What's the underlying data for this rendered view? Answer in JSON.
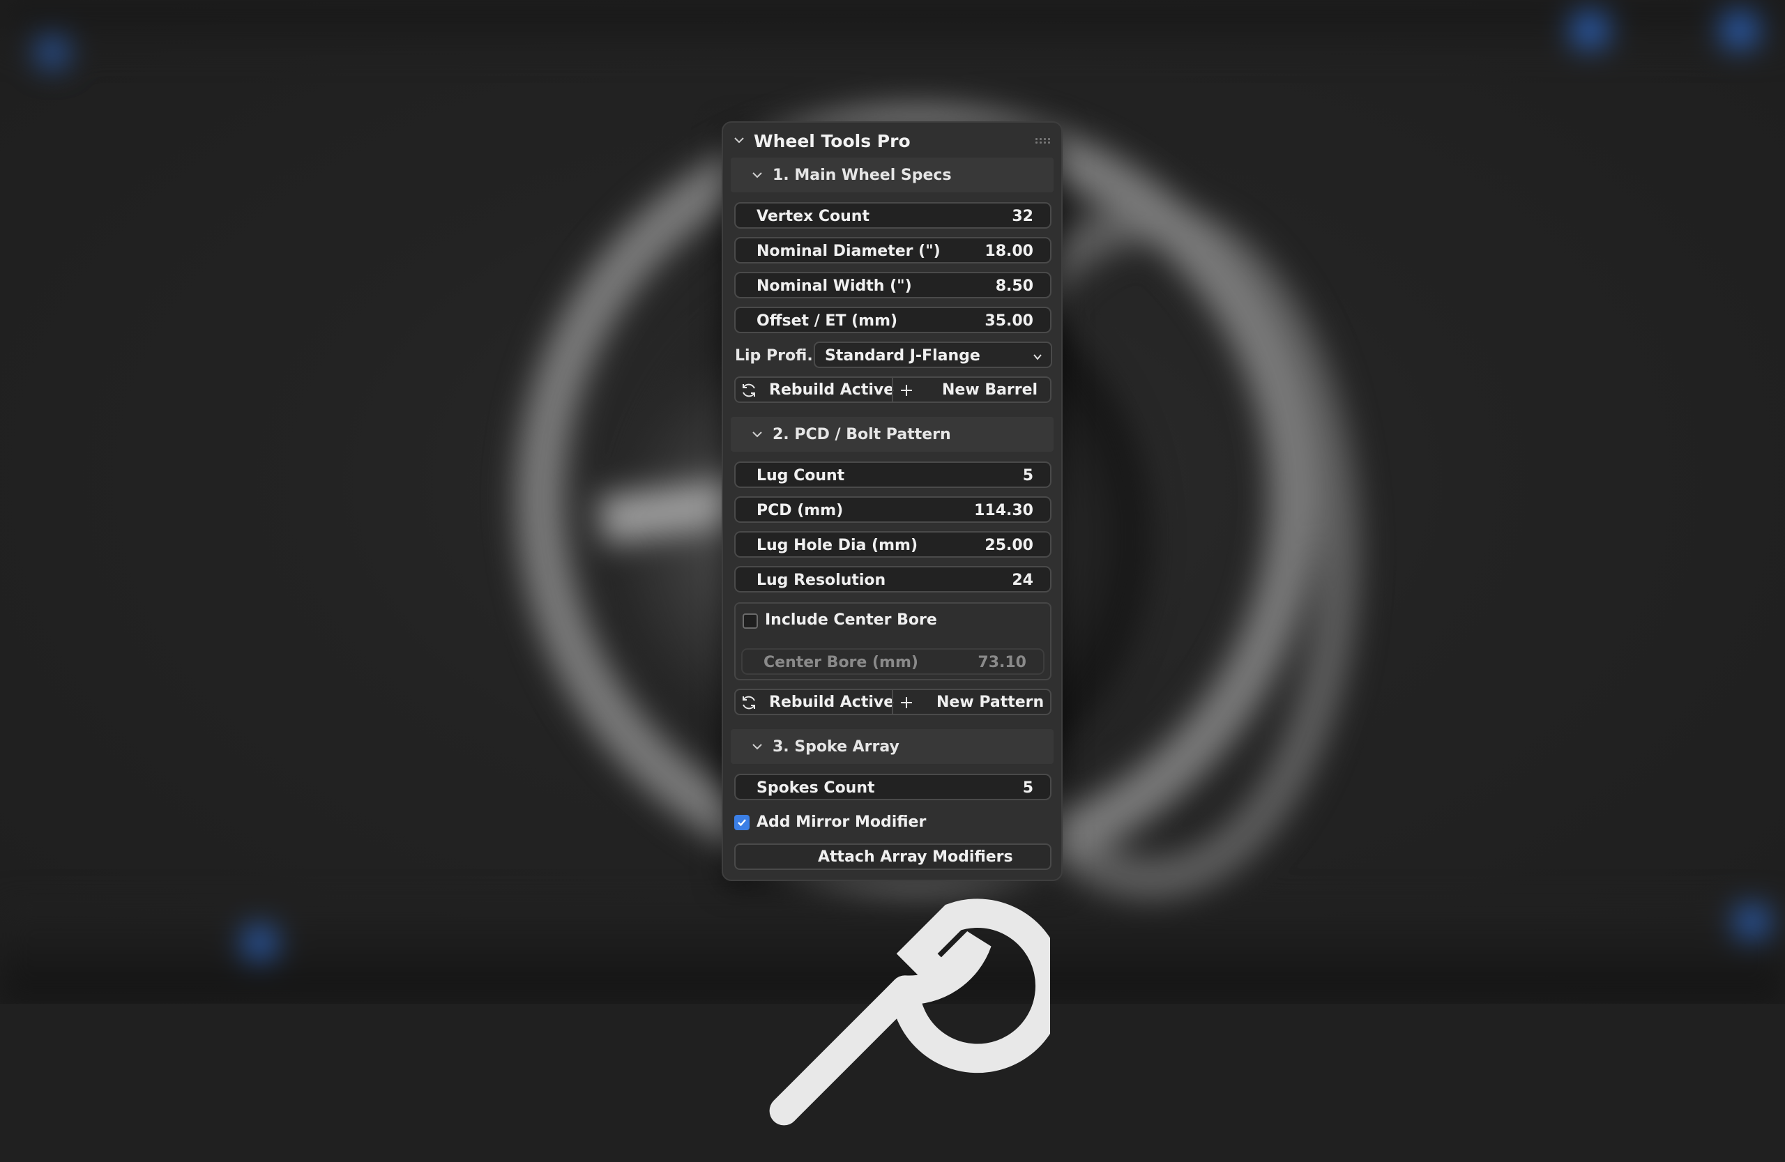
{
  "panel": {
    "title": "Wheel Tools Pro"
  },
  "main_specs": {
    "title": "1. Main Wheel Specs",
    "fields": [
      {
        "label": "Vertex Count",
        "value": "32"
      },
      {
        "label": "Nominal Diameter (\")",
        "value": "18.00"
      },
      {
        "label": "Nominal Width (\")",
        "value": "8.50"
      },
      {
        "label": "Offset / ET (mm)",
        "value": "35.00"
      }
    ],
    "lip_profile_label": "Lip Profi...",
    "lip_profile_value": "Standard J-Flange",
    "rebuild_label": "Rebuild Active",
    "new_label": "New Barrel"
  },
  "pcd": {
    "title": "2. PCD / Bolt Pattern",
    "fields": [
      {
        "label": "Lug Count",
        "value": "5"
      },
      {
        "label": "PCD (mm)",
        "value": "114.30"
      },
      {
        "label": "Lug Hole Dia (mm)",
        "value": "25.00"
      },
      {
        "label": "Lug Resolution",
        "value": "24"
      }
    ],
    "include_bore_label": "Include Center Bore",
    "include_bore_checked": false,
    "center_bore_label": "Center Bore (mm)",
    "center_bore_value": "73.10",
    "rebuild_label": "Rebuild Active",
    "new_label": "New Pattern"
  },
  "spokes": {
    "title": "3. Spoke Array",
    "count_label": "Spokes Count",
    "count_value": "5",
    "mirror_label": "Add Mirror Modifier",
    "mirror_checked": true,
    "attach_label": "Attach Array Modifiers"
  },
  "colors": {
    "accent": "#3b7fe6",
    "panel_bg": "#303030",
    "field_bg": "#222222"
  },
  "icons": [
    "chevron-down-icon",
    "grip-icon",
    "refresh-icon",
    "plus-icon",
    "wrench-icon",
    "checkmark-icon"
  ]
}
